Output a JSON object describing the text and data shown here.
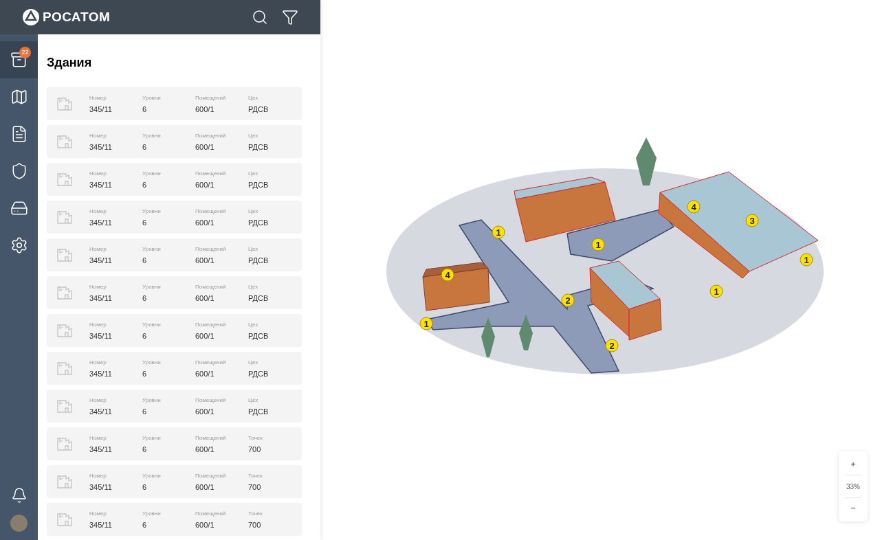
{
  "header": {
    "logo": "РОСАТОМ"
  },
  "sidebar": {
    "items": [
      {
        "kind": "archive",
        "selected": true,
        "badge": "22"
      },
      {
        "kind": "map",
        "selected": false
      },
      {
        "kind": "document",
        "selected": false
      },
      {
        "kind": "shield",
        "selected": false
      },
      {
        "kind": "drive",
        "selected": false
      },
      {
        "kind": "settings",
        "selected": false
      }
    ]
  },
  "panel": {
    "title": "Здания",
    "buildings": [
      {
        "fields": [
          {
            "label": "Номер",
            "value": "345/11"
          },
          {
            "label": "Уровни",
            "value": "6"
          },
          {
            "label": "Помещений",
            "value": "600/1"
          },
          {
            "label": "Цех",
            "value": "РДСВ"
          }
        ]
      },
      {
        "fields": [
          {
            "label": "Номер",
            "value": "345/11"
          },
          {
            "label": "Уровни",
            "value": "6"
          },
          {
            "label": "Помещений",
            "value": "600/1"
          },
          {
            "label": "Цех",
            "value": "РДСВ"
          }
        ]
      },
      {
        "fields": [
          {
            "label": "Номер",
            "value": "345/11"
          },
          {
            "label": "Уровни",
            "value": "6"
          },
          {
            "label": "Помещений",
            "value": "600/1"
          },
          {
            "label": "Цех",
            "value": "РДСВ"
          }
        ]
      },
      {
        "fields": [
          {
            "label": "Номер",
            "value": "345/11"
          },
          {
            "label": "Уровни",
            "value": "6"
          },
          {
            "label": "Помещений",
            "value": "600/1"
          },
          {
            "label": "Цех",
            "value": "РДСВ"
          }
        ]
      },
      {
        "fields": [
          {
            "label": "Номер",
            "value": "345/11"
          },
          {
            "label": "Уровни",
            "value": "6"
          },
          {
            "label": "Помещений",
            "value": "600/1"
          },
          {
            "label": "Цех",
            "value": "РДСВ"
          }
        ]
      },
      {
        "fields": [
          {
            "label": "Номер",
            "value": "345/11"
          },
          {
            "label": "Уровни",
            "value": "6"
          },
          {
            "label": "Помещений",
            "value": "600/1"
          },
          {
            "label": "Цех",
            "value": "РДСВ"
          }
        ]
      },
      {
        "fields": [
          {
            "label": "Номер",
            "value": "345/11"
          },
          {
            "label": "Уровни",
            "value": "6"
          },
          {
            "label": "Помещений",
            "value": "600/1"
          },
          {
            "label": "Цех",
            "value": "РДСВ"
          }
        ]
      },
      {
        "fields": [
          {
            "label": "Номер",
            "value": "345/11"
          },
          {
            "label": "Уровни",
            "value": "6"
          },
          {
            "label": "Помещений",
            "value": "600/1"
          },
          {
            "label": "Цех",
            "value": "РДСВ"
          }
        ]
      },
      {
        "fields": [
          {
            "label": "Номер",
            "value": "345/11"
          },
          {
            "label": "Уровни",
            "value": "6"
          },
          {
            "label": "Помещений",
            "value": "600/1"
          },
          {
            "label": "Цех",
            "value": "РДСВ"
          }
        ]
      },
      {
        "fields": [
          {
            "label": "Номер",
            "value": "345/11"
          },
          {
            "label": "Уровни",
            "value": "6"
          },
          {
            "label": "Помещений",
            "value": "600/1"
          },
          {
            "label": "Точек",
            "value": "700"
          }
        ]
      },
      {
        "fields": [
          {
            "label": "Номер",
            "value": "345/11"
          },
          {
            "label": "Уровни",
            "value": "6"
          },
          {
            "label": "Помещений",
            "value": "600/1"
          },
          {
            "label": "Точек",
            "value": "700"
          }
        ]
      },
      {
        "fields": [
          {
            "label": "Номер",
            "value": "345/11"
          },
          {
            "label": "Уровни",
            "value": "6"
          },
          {
            "label": "Помещений",
            "value": "600/1"
          },
          {
            "label": "Точек",
            "value": "700"
          }
        ]
      }
    ]
  },
  "site_plan": {
    "markers": [
      {
        "label": "1"
      },
      {
        "label": "1"
      },
      {
        "label": "4"
      },
      {
        "label": "3"
      },
      {
        "label": "1"
      },
      {
        "label": "1"
      },
      {
        "label": "4"
      },
      {
        "label": "1"
      },
      {
        "label": "2"
      },
      {
        "label": "2"
      }
    ]
  },
  "zoom": {
    "plus": "+",
    "level": "33%",
    "minus": "−"
  }
}
